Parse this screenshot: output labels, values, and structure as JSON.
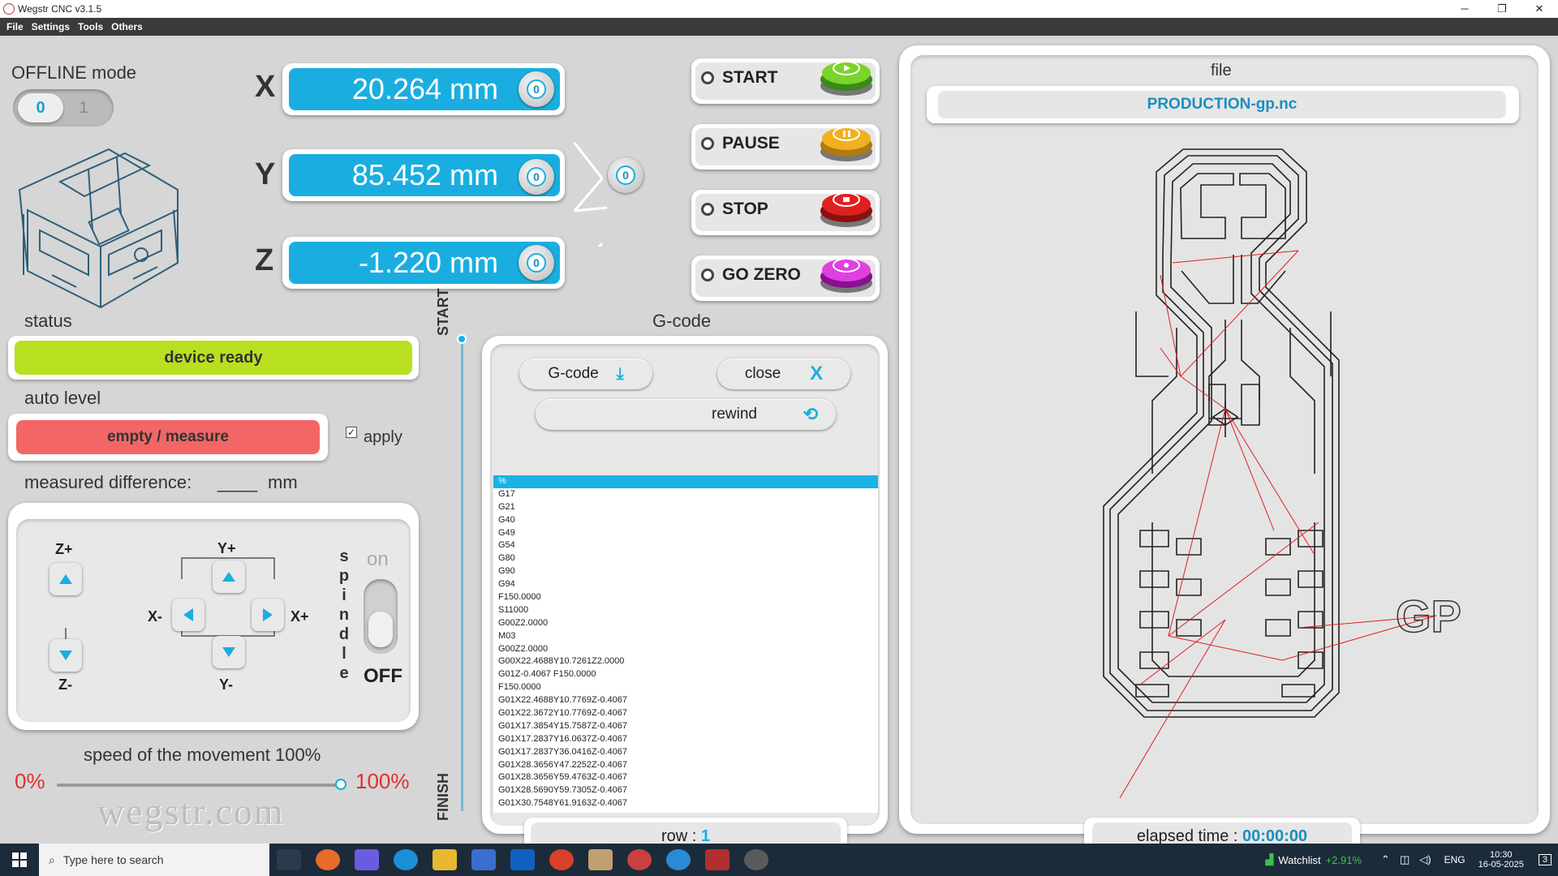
{
  "window": {
    "title": "Wegstr CNC  v3.1.5",
    "minimize": "─",
    "restore": "❐",
    "close": "✕"
  },
  "menu": [
    "File",
    "Settings",
    "Tools",
    "Others"
  ],
  "mode": {
    "label": "OFFLINE mode",
    "toggle_off": "0",
    "toggle_on": "1"
  },
  "axes": [
    {
      "axis": "X",
      "value": "20.264 mm"
    },
    {
      "axis": "Y",
      "value": "85.452 mm"
    },
    {
      "axis": "Z",
      "value": "-1.220 mm"
    }
  ],
  "zero_symbol": "0",
  "controls": {
    "start": "START",
    "pause": "PAUSE",
    "stop": "STOP",
    "go_zero": "GO ZERO"
  },
  "status": {
    "label": "status",
    "value": "device ready"
  },
  "auto_level": {
    "label": "auto level",
    "button": "empty / measure",
    "apply_label": "apply",
    "apply_checked": true
  },
  "measured": {
    "label": "measured difference:",
    "value": "____",
    "unit": "mm"
  },
  "jog": {
    "z_plus": "Z+",
    "z_minus": "Z-",
    "y_plus": "Y+",
    "y_minus": "Y-",
    "x_plus": "X+",
    "x_minus": "X-"
  },
  "spindle": {
    "letters": [
      "s",
      "p",
      "i",
      "n",
      "d",
      "l",
      "e"
    ],
    "on": "on",
    "off": "OFF"
  },
  "speed": {
    "label": "speed of the movement 100%",
    "min": "0%",
    "max": "100%",
    "value": 1.0
  },
  "watermark": "wegstr.com",
  "progress": {
    "start": "START",
    "finish": "FINISH"
  },
  "gcode": {
    "title": "G-code",
    "load_button": "G-code",
    "close_button": "close",
    "close_icon": "X",
    "rewind_button": "rewind",
    "lines": [
      "%",
      "G17",
      "G21",
      "G40",
      "G49",
      "G54",
      "G80",
      "G90",
      "G94",
      "F150.0000",
      "S11000",
      "G00Z2.0000",
      "M03",
      "G00Z2.0000",
      "G00X22.4688Y10.7261Z2.0000",
      "G01Z-0.4067 F150.0000",
      "F150.0000",
      "G01X22.4688Y10.7769Z-0.4067",
      "G01X22.3672Y10.7769Z-0.4067",
      "G01X17.3854Y15.7587Z-0.4067",
      "G01X17.2837Y16.0637Z-0.4067",
      "G01X17.2837Y36.0416Z-0.4067",
      "G01X28.3656Y47.2252Z-0.4067",
      "G01X28.3656Y59.4763Z-0.4067",
      "G01X28.5690Y59.7305Z-0.4067",
      "G01X30.7548Y61.9163Z-0.4067"
    ],
    "row_label": "row :",
    "row_value": "1"
  },
  "file_panel": {
    "label": "file",
    "filename": "PRODUCTION-gp.nc",
    "elapsed_label": "elapsed time :",
    "elapsed_value": "00:00:00",
    "logo_text": "GP"
  },
  "taskbar": {
    "search_placeholder": "Type here to search",
    "watchlist": "Watchlist",
    "watchlist_change": "+2.91%",
    "lang": "ENG",
    "time": "10:30",
    "date": "16-05-2025",
    "notif": "3"
  },
  "colors": {
    "accent": "#1aaee0",
    "status_ok": "#b8e020",
    "auto_level_btn": "#f26666",
    "red_text": "#e03030"
  }
}
